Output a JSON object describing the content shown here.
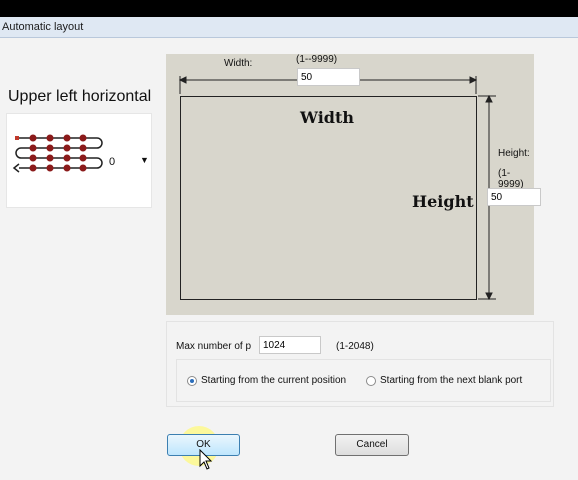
{
  "window": {
    "title": "Automatic layout"
  },
  "layout_mode": {
    "label": "Upper left horizontal",
    "selected_value": "0",
    "icon": "serpentine-layout-icon"
  },
  "width": {
    "caption": "Width:",
    "range": "(1--9999)",
    "value": "50",
    "diagram_label": "Width"
  },
  "height": {
    "caption": "Height:",
    "range": "(1-9999)",
    "value": "50",
    "diagram_label": "Height"
  },
  "max_number": {
    "label": "Max number of p",
    "value": "1024",
    "range": "(1-2048)"
  },
  "start_options": [
    {
      "label": "Starting from the current position",
      "checked": true
    },
    {
      "label": "Starting from the next blank port",
      "checked": false
    }
  ],
  "buttons": {
    "ok": "OK",
    "cancel": "Cancel"
  },
  "colors": {
    "title_bar": "#dfe8f3",
    "diagram_bg": "#d8d6cc",
    "pattern_dots": "#8b1a1a",
    "accent": "#2a6ebb"
  }
}
